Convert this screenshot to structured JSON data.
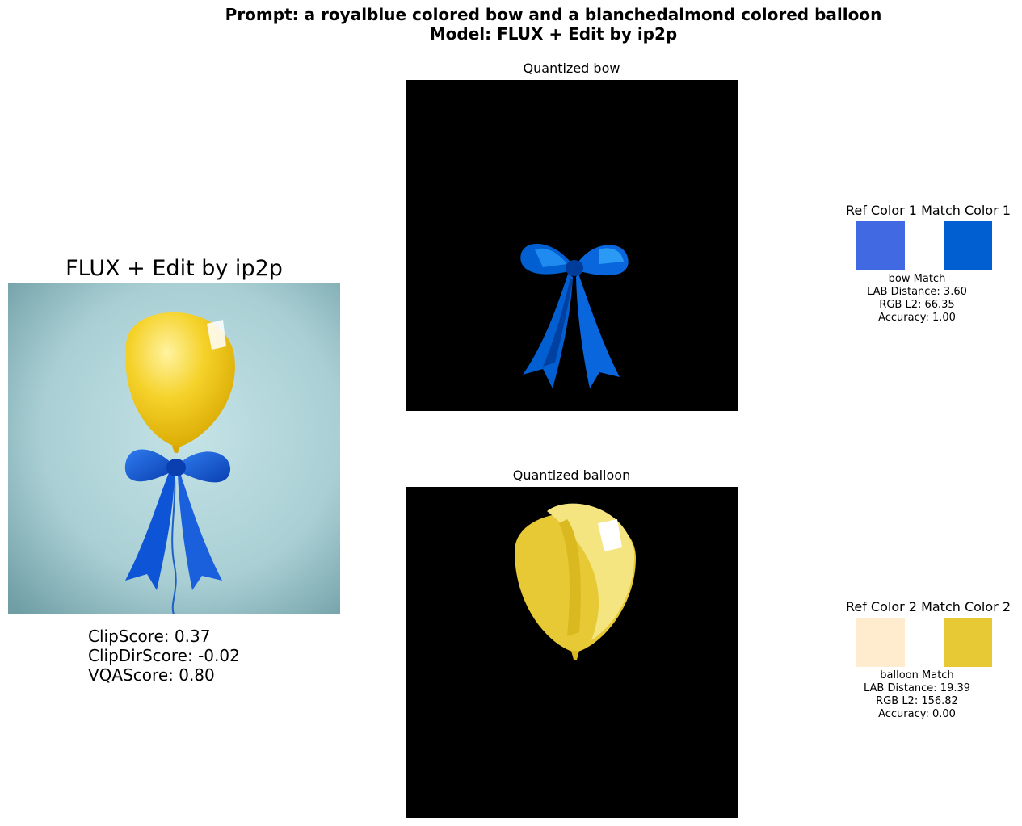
{
  "header": {
    "prompt_line": "Prompt: a royalblue colored bow and a blanchedalmond colored balloon",
    "model_line": "Model: FLUX + Edit by ip2p"
  },
  "main": {
    "title": "FLUX + Edit by ip2p",
    "scores": {
      "clip": "ClipScore: 0.37",
      "clipdir": "ClipDirScore: -0.02",
      "vqa": "VQAScore: 0.80"
    }
  },
  "panels": [
    {
      "title": "Quantized bow"
    },
    {
      "title": "Quantized balloon"
    }
  ],
  "matches": [
    {
      "ref_label": "Ref Color 1",
      "match_label": "Match Color 1",
      "ref_color": "#4169e1",
      "match_color": "#025fd2",
      "name": "bow Match",
      "lab": "LAB Distance: 3.60",
      "rgb": "RGB L2: 66.35",
      "accuracy": "Accuracy: 1.00"
    },
    {
      "ref_label": "Ref Color 2",
      "match_label": "Match Color 2",
      "ref_color": "#ffebcd",
      "match_color": "#e6c935",
      "name": "balloon Match",
      "lab": "LAB Distance: 19.39",
      "rgb": "RGB L2: 156.82",
      "accuracy": "Accuracy: 0.00"
    }
  ]
}
